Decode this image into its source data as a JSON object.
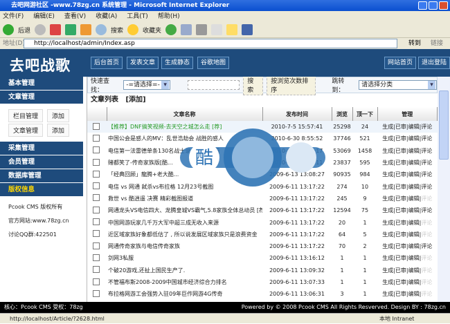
{
  "window": {
    "title": "去吧网游社区 -www.78zg.cn 系统管理 - Microsoft Internet Explorer"
  },
  "menu": [
    "文件(F)",
    "编辑(E)",
    "查看(V)",
    "收藏(A)",
    "工具(T)",
    "帮助(H)"
  ],
  "toolbar": {
    "back": "后退",
    "search": "搜索",
    "favorites": "收藏夹"
  },
  "address": {
    "label": "地址(D)",
    "url": "http://localhost/admin/Index.asp",
    "go": "转到",
    "links": "链接"
  },
  "header": {
    "logo": "去吧战歌",
    "nav": [
      "后台首页",
      "发表文章",
      "生成静态",
      "谷歌地图"
    ],
    "right": [
      "网站首页",
      "退出登陆"
    ]
  },
  "sidebar": {
    "items_top": [
      "基本管理",
      "文章管理"
    ],
    "sub": [
      [
        "栏目管理",
        "添加"
      ],
      [
        "文章管理",
        "添加"
      ]
    ],
    "items_bottom": [
      "采集管理",
      "会员管理",
      "数据库管理",
      "版权信息"
    ],
    "info": [
      "Pcook CMS 版权所有",
      "官方网站:www.78zg.cn",
      "讨论QQ群:422501"
    ]
  },
  "search": {
    "label": "快速查找：",
    "select": "-=请选择=-",
    "input": "",
    "search_btn": "搜索",
    "sort_btn": "按浏览次数排序",
    "jump_label": "跳转到：",
    "jump_select": "请选择分类"
  },
  "list": {
    "title": "文章列表",
    "add": "[添加]",
    "columns": [
      "文章名称",
      "发布时间",
      "浏览",
      "顶一下",
      "管理"
    ],
    "actions": [
      "生成",
      "已审",
      "编辑",
      "评论"
    ],
    "rows": [
      {
        "title": "【推荐】DNF搞笑视频-去天空之城怎么走 [荐]",
        "time": "2010-7-5 15:57:41",
        "views": "25298",
        "up": "24",
        "green": true,
        "comment": true
      },
      {
        "title": "中国公会是感人的MV：乱世浩劫会 战胜的感人",
        "time": "2010-6-30 8:55:52",
        "views": "37746",
        "up": "521",
        "comment": true
      },
      {
        "title": "电信第一法雷德单条130名战士录像 值得一看",
        "time": "2010-6-29 7:36:17",
        "views": "53069",
        "up": "1458",
        "comment": true
      },
      {
        "title": "赌都笑了-传奇家族版[酷...",
        "time": "2010-6-2 22:52:11",
        "views": "23837",
        "up": "595",
        "comment": true
      },
      {
        "title": "「经典回顾」龍腾+老大酷...",
        "time": "2009-6-13 13:08:27",
        "views": "90935",
        "up": "984",
        "comment": true
      },
      {
        "title": "电信 vs 网通 弑杀vs布拉格 12月23号截图",
        "time": "2009-6-11 13:17:22",
        "views": "274",
        "up": "10",
        "comment": true
      },
      {
        "title": "救世 vs 酷逍遥 决赛 精彩截图报道",
        "time": "2009-6-11 13:17:22",
        "views": "245",
        "up": "9",
        "comment": false
      },
      {
        "title": "网通龙头VS电信四大、龙腾皇城VS霸气,5.8家族全体总动员 [荐]",
        "time": "2009-6-11 13:17:22",
        "views": "12594",
        "up": "75",
        "comment": true
      },
      {
        "title": "中国网游玩家几千万大军中超三成无收入来源",
        "time": "2009-6-11 13:17:22",
        "views": "20",
        "up": "1",
        "comment": false
      },
      {
        "title": "近区域家族好象都低估了 , 所以说发展区域家族只是浪费资金",
        "time": "2009-6-11 13:17:22",
        "views": "64",
        "up": "5",
        "comment": false
      },
      {
        "title": "网通传奇家族与电信传奇家族",
        "time": "2009-6-11 13:17:22",
        "views": "70",
        "up": "2",
        "comment": true
      },
      {
        "title": "剑网3私服",
        "time": "2009-6-11 13:16:12",
        "views": "1",
        "up": "1",
        "comment": false
      },
      {
        "title": "个破20游戏,还扯上国民生产了.",
        "time": "2009-6-11 13:09:32",
        "views": "1",
        "up": "1",
        "comment": false
      },
      {
        "title": "不管福布斯2008-2009中国城市经济综合力排名",
        "time": "2009-6-11 13:07:33",
        "views": "1",
        "up": "1",
        "comment": false
      },
      {
        "title": "布拉格网游工会强势入驻09年巨作网游4G传奇",
        "time": "2009-6-11 13:06:31",
        "views": "3",
        "up": "1",
        "comment": false
      }
    ]
  },
  "footer": {
    "left": "核心：Pcook CMS 受权：78zg",
    "right": "Powered by © 2008 Pcook CMS All Rights Resverved. Design BY : 78zg.cn"
  },
  "status": {
    "url": "http://localhost/Article/?2628.html",
    "zone": "本地 Intranet"
  },
  "watermark": "酷"
}
